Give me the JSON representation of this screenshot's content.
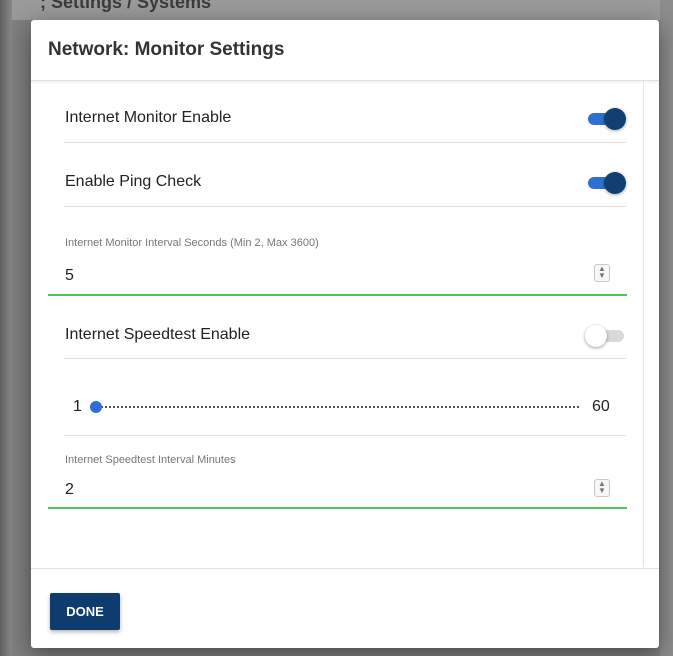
{
  "background": {
    "partial_title": "; Settings / Systems"
  },
  "dialog": {
    "title": "Network: Monitor Settings"
  },
  "settings": {
    "internet_monitor_enable": {
      "label": "Internet Monitor Enable",
      "on": true
    },
    "enable_ping_check": {
      "label": "Enable Ping Check",
      "on": true
    },
    "monitor_interval": {
      "label": "Internet Monitor Interval Seconds (Min 2, Max 3600)",
      "value": "5"
    },
    "speedtest_enable": {
      "label": "Internet Speedtest Enable",
      "on": false
    },
    "speedtest_slider": {
      "min_label": "1",
      "max_label": "60",
      "value": 1,
      "min": 1,
      "max": 60
    },
    "speedtest_interval": {
      "label": "Internet Speedtest Interval Minutes",
      "value": "2"
    }
  },
  "footer": {
    "done_label": "DONE"
  },
  "colors": {
    "accent": "#2f6fd1",
    "toggle_knob_on": "#0f3f73",
    "field_underline": "#4cc45a",
    "primary_button": "#0e3c6e"
  },
  "icons": {
    "stepper": "stepper-arrows-icon",
    "slider_thumb": "slider-thumb"
  }
}
